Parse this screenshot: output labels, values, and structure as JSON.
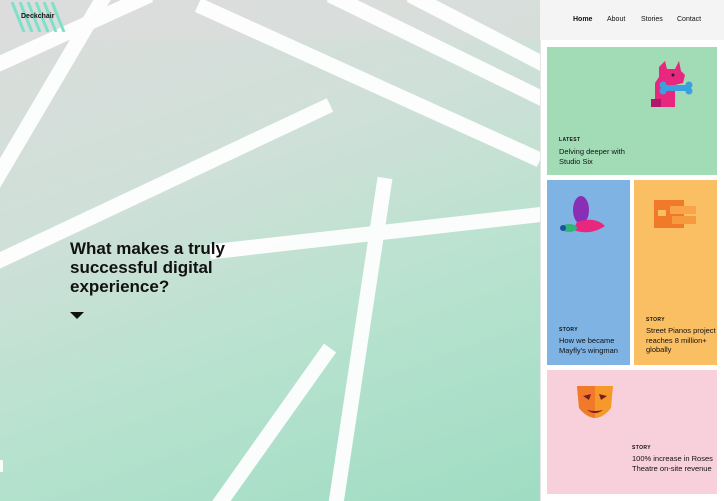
{
  "brand": {
    "name": "Deckchair"
  },
  "nav": {
    "items": [
      "Home",
      "About",
      "Stories",
      "Contact"
    ],
    "active": "Home"
  },
  "hero": {
    "headline": "What makes a truly successful digital experience?"
  },
  "cards": [
    {
      "tag": "LATEST",
      "title": "Delving deeper with Studio Six",
      "bg": "#a2dcb6",
      "icon": "dog-bone-icon"
    },
    {
      "tag": "STORY",
      "title": "How we became Mayfly's wingman",
      "bg": "#7fb3e4",
      "icon": "mayfly-icon"
    },
    {
      "tag": "STORY",
      "title": "Street Pianos project reaches 8 million+ globally",
      "bg": "#fbbf63",
      "icon": "piano-icon"
    },
    {
      "tag": "STORY",
      "title": "100% increase in Roses Theatre on-site revenue",
      "bg": "#f8d0dc",
      "icon": "theatre-mask-icon"
    }
  ]
}
